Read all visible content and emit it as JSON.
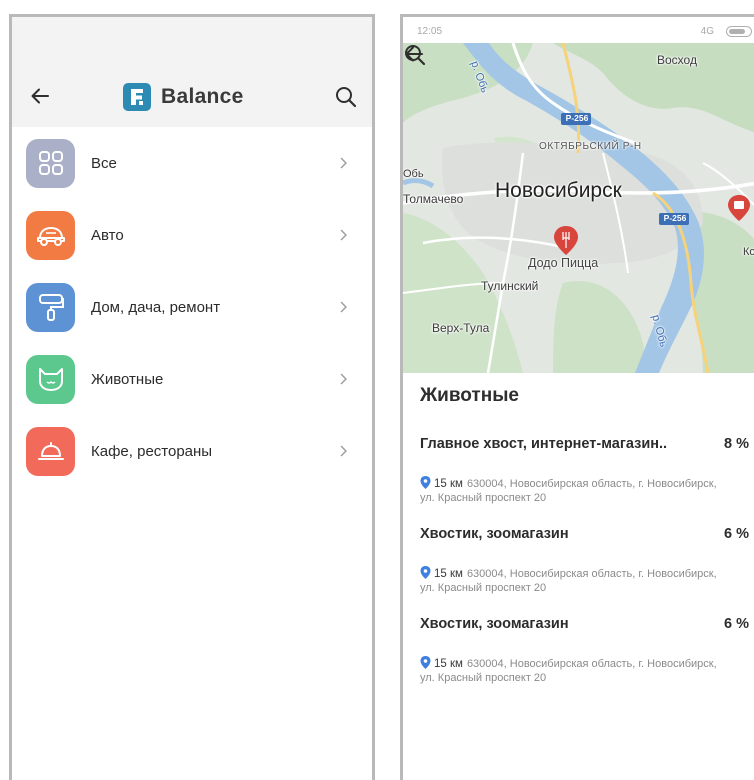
{
  "left": {
    "brand": {
      "logo_letter": "F.",
      "name": "Balance"
    },
    "categories": [
      {
        "label": "Все",
        "icon": "grid-icon",
        "color": "#a9b0c8"
      },
      {
        "label": "Авто",
        "icon": "car-icon",
        "color": "#f27b43"
      },
      {
        "label": "Дом, дача, ремонт",
        "icon": "paint-roller-icon",
        "color": "#5d92d4"
      },
      {
        "label": "Животные",
        "icon": "cat-icon",
        "color": "#5cc88e"
      },
      {
        "label": "Кафе, рестораны",
        "icon": "cloche-icon",
        "color": "#f26a5a"
      }
    ],
    "chevron": "›"
  },
  "right": {
    "status": {
      "time": "12:05",
      "network": "4G"
    },
    "map": {
      "labels": {
        "voskhod": "Восход",
        "river_top": "р. Обь",
        "river_bottom": "р. Обь",
        "r256_top": "Р-256",
        "r256_right": "Р-256",
        "oktyabrsky": "ОКТЯБРЬСКИЙ Р-Н",
        "ob_left": "Обь",
        "tolmachevo": "Толмачево",
        "novosibirsk": "Новосибирск",
        "dodo": "Додо Пицца",
        "tulinsky": "Тулинский",
        "verkh_tula": "Верх-Тула",
        "ko": "Ко"
      }
    },
    "section_title": "Животные",
    "items": [
      {
        "name": "Главное хвост, интернет-магазин..",
        "percent": "8 %",
        "distance": "15 км",
        "address": "630004, Новосибирская область, г. Новосибирск, ул. Красный проспект 20"
      },
      {
        "name": "Хвостик, зоомагазин",
        "percent": "6 %",
        "distance": "15 км",
        "address": "630004, Новосибирская область, г. Новосибирск, ул. Красный проспект 20"
      },
      {
        "name": "Хвостик, зоомагазин",
        "percent": "6 %",
        "distance": "15 км",
        "address": "630004, Новосибирская область, г. Новосибирск, ул. Красный проспект 20"
      }
    ]
  }
}
